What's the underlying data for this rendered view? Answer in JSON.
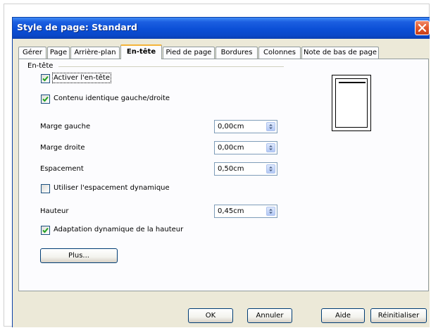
{
  "window": {
    "title": "Style de page: Standard"
  },
  "tabs": [
    {
      "label": "Gérer"
    },
    {
      "label": "Page"
    },
    {
      "label": "Arrière-plan"
    },
    {
      "label": "En-tête",
      "active": true
    },
    {
      "label": "Pied de page"
    },
    {
      "label": "Bordures"
    },
    {
      "label": "Colonnes"
    },
    {
      "label": "Note de bas de page"
    }
  ],
  "header_section": {
    "group_label": "En-tête",
    "activate_header": {
      "label": "Activer l'en-tête",
      "checked": true
    },
    "same_content": {
      "label": "Contenu identique gauche/droite",
      "checked": true
    },
    "left_margin": {
      "label": "Marge gauche",
      "value": "0,00cm"
    },
    "right_margin": {
      "label": "Marge droite",
      "value": "0,00cm"
    },
    "spacing": {
      "label": "Espacement",
      "value": "0,50cm"
    },
    "dynamic_spacing": {
      "label": "Utiliser l'espacement dynamique",
      "checked": false
    },
    "height": {
      "label": "Hauteur",
      "value": "0,45cm"
    },
    "autofit_height": {
      "label": "Adaptation dynamique de la hauteur",
      "checked": true
    },
    "more_button": "Plus..."
  },
  "footer_buttons": {
    "ok": "OK",
    "cancel": "Annuler",
    "help": "Aide",
    "reset": "Réinitialiser"
  },
  "icons": {
    "close": "close-icon",
    "check": "check-icon",
    "spin": "spin-arrows-icon"
  },
  "colors": {
    "titlebar": "#0b4fd6",
    "dialog_bg": "#ece9d8",
    "active_tab_accent": "#f4b43a",
    "close_button": "#e2582c"
  }
}
